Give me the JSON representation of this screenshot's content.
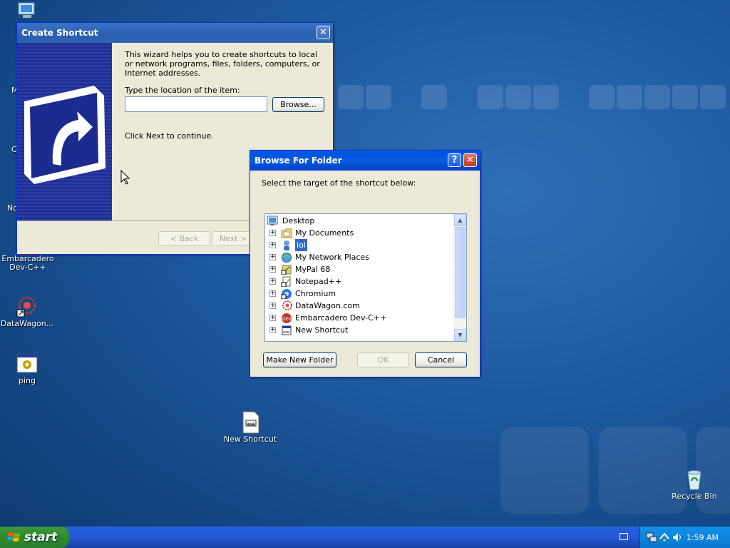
{
  "desktop": {
    "icons": [
      {
        "label": "Embarcadero Dev-C++",
        "icon": "devcpp-icon"
      },
      {
        "label": "DataWagon...",
        "icon": "datawagon-icon"
      },
      {
        "label": "ping",
        "icon": "batch-file-icon"
      },
      {
        "label": "New Shortcut",
        "icon": "shortcut-file-icon"
      },
      {
        "label": "Recycle Bin",
        "icon": "recycle-bin-icon"
      }
    ],
    "partial_labels": {
      "a": "M",
      "b": "C",
      "c": "No"
    }
  },
  "create_shortcut": {
    "title": "Create Shortcut",
    "intro": "This wizard helps you to create shortcuts to local or network programs, files, folders, computers, or Internet addresses.",
    "location_label": "Type the location of the item:",
    "location_value": "",
    "browse_label": "Browse...",
    "continue_text": "Click Next to continue.",
    "back_label": "< Back",
    "next_label": "Next >"
  },
  "browse_folder": {
    "title": "Browse For Folder",
    "help_label": "?",
    "close_label": "✕",
    "prompt": "Select the target of the shortcut below:",
    "tree_root": "Desktop",
    "tree_items": [
      {
        "label": "My Documents",
        "icon": "folder-documents-icon"
      },
      {
        "label": "lol",
        "icon": "user-computer-icon",
        "selected": true
      },
      {
        "label": "My Network Places",
        "icon": "network-places-icon"
      },
      {
        "label": "MyPal 68",
        "icon": "mypal-icon"
      },
      {
        "label": "Notepad++",
        "icon": "notepadpp-icon"
      },
      {
        "label": "Chromium",
        "icon": "chromium-icon"
      },
      {
        "label": "DataWagon.com",
        "icon": "datawagon-icon"
      },
      {
        "label": "Embarcadero Dev-C++",
        "icon": "devcpp-icon"
      },
      {
        "label": "New Shortcut",
        "icon": "shortcut-file-icon"
      }
    ],
    "make_folder_label": "Make New Folder",
    "ok_label": "OK",
    "cancel_label": "Cancel"
  },
  "taskbar": {
    "start_label": "start",
    "clock": "1:59 AM"
  },
  "colors": {
    "selection": "#316ac5",
    "title_active": "#0054e3",
    "desktop": "#1f5aa0"
  }
}
